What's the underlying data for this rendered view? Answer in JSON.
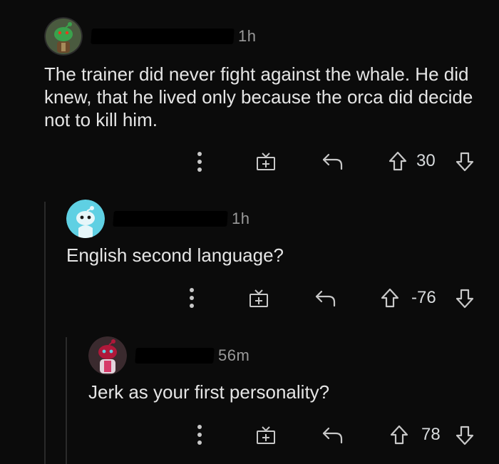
{
  "comments": [
    {
      "time": "1h",
      "body": "The trainer did never fight against the whale. He did\nknew, that he lived only because the orca did decide\nnot to kill him.",
      "score": "30",
      "avatar_color": "#3a8f4a"
    },
    {
      "time": "1h",
      "body": "English second language?",
      "score": "-76",
      "avatar_color": "#5fd0e3"
    },
    {
      "time": "56m",
      "body": "Jerk as your first personality?",
      "score": "78",
      "avatar_color": "#b0183a"
    }
  ],
  "icons": {
    "more": "more-options-icon",
    "award": "award-gift-icon",
    "reply": "reply-arrow-icon",
    "upvote": "upvote-arrow-icon",
    "downvote": "downvote-arrow-icon"
  },
  "colors": {
    "background": "#0b0b0b",
    "text": "#e5e5e5",
    "muted": "#9a9a9a",
    "thread_line": "#2a2a2a"
  }
}
